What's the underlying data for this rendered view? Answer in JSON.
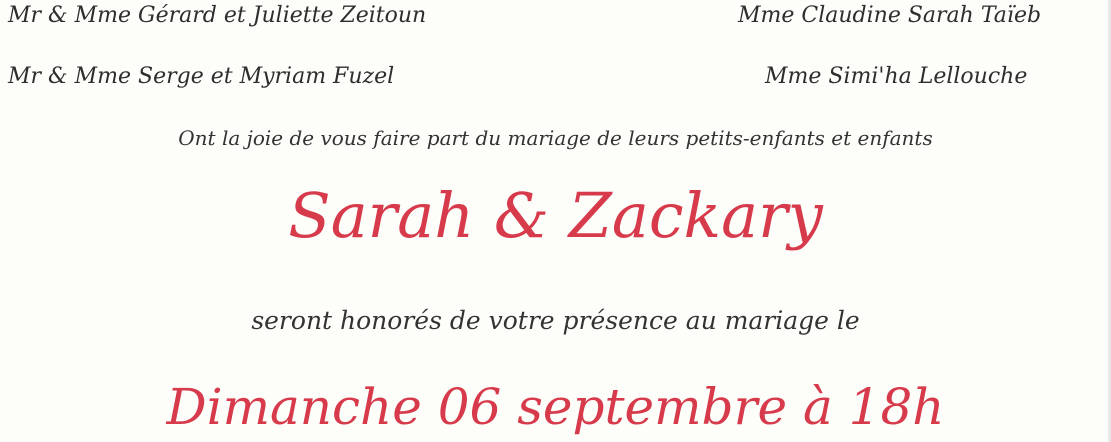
{
  "families": {
    "left_1": "Mr & Mme Gérard et Juliette Zeitoun",
    "left_2": "Mr & Mme Serge et Myriam Fuzel",
    "right_1": "Mme Claudine Sarah Taïeb",
    "right_2": "Mme Simi'ha Lellouche"
  },
  "announcement": "Ont la joie de vous faire part du mariage de leurs petits-enfants et enfants",
  "couple": "Sarah & Zackary",
  "honor_line": "seront honorés de votre présence au mariage le",
  "date_line": "Dimanche 06 septembre à 18h",
  "colors": {
    "accent": "#d63a4b",
    "text": "#2b2b2b",
    "background": "#fdfdf9"
  }
}
